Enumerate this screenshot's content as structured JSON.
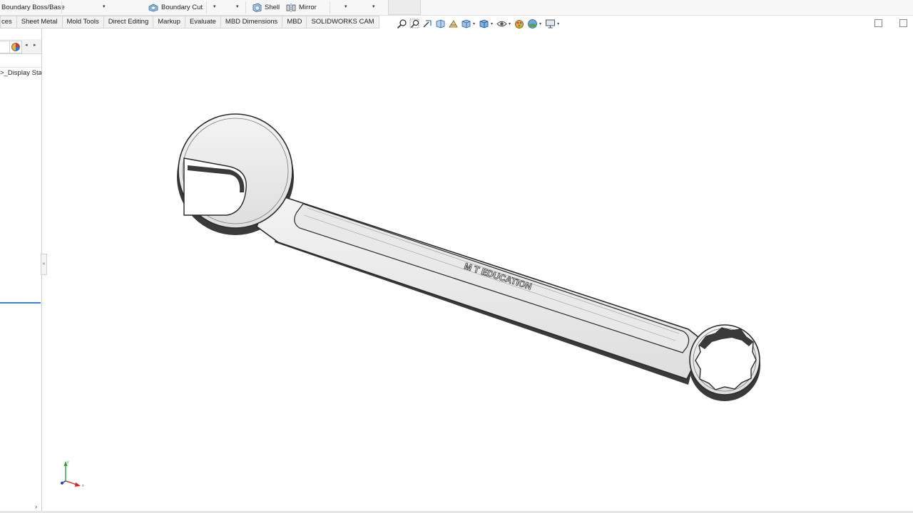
{
  "toolbar": {
    "boundary_boss_label": "Boundary Boss/Base",
    "boundary_cut_label": "Boundary Cut",
    "shell_label": "Shell",
    "mirror_label": "Mirror"
  },
  "tabs": [
    {
      "label": "ces"
    },
    {
      "label": "Sheet Metal"
    },
    {
      "label": "Mold Tools"
    },
    {
      "label": "Direct Editing"
    },
    {
      "label": "Markup"
    },
    {
      "label": "Evaluate"
    },
    {
      "label": "MBD Dimensions"
    },
    {
      "label": "MBD"
    },
    {
      "label": "SOLIDWORKS CAM"
    }
  ],
  "feature_tree": {
    "display_state_item": ">_Display Stat"
  },
  "model": {
    "engraving_text": "M T EDUCATION",
    "name": "combination wrench"
  },
  "triad": {
    "x_label": "x",
    "y_label": "y",
    "x_color": "#d62020",
    "y_color": "#2aa02a",
    "z_color": "#2040d0"
  },
  "colors": {
    "accent": "#3b7dd8",
    "wrench_body": "#ececec",
    "wrench_edge": "#2a2a2a"
  }
}
